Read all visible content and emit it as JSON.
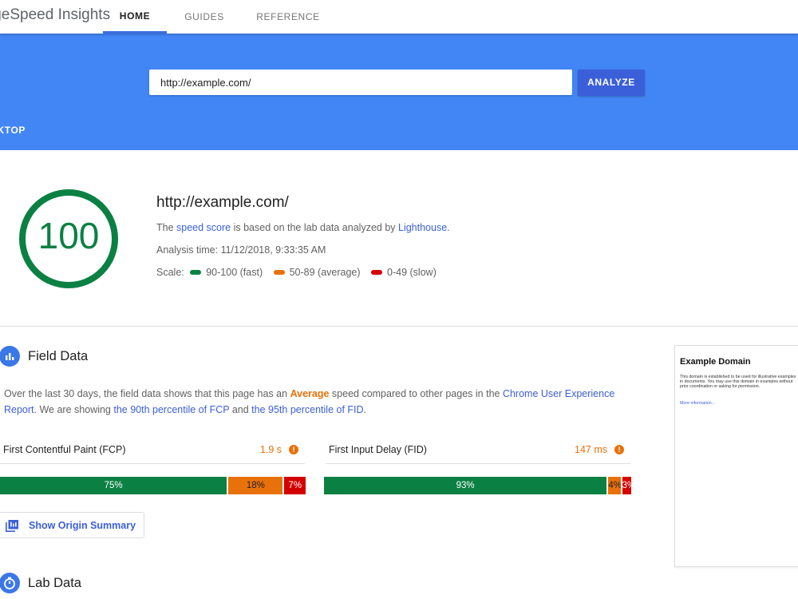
{
  "app": {
    "title": "PageSpeed Insights"
  },
  "nav": {
    "tabs": [
      {
        "label": "HOME"
      },
      {
        "label": "GUIDES"
      },
      {
        "label": "REFERENCE"
      }
    ]
  },
  "search": {
    "value": "http://example.com/",
    "analyze_label": "ANALYZE",
    "device_tab": "DESKTOP"
  },
  "summary": {
    "score": "100",
    "url": "http://example.com/",
    "line1_pre": "The ",
    "line1_link1": "speed score",
    "line1_mid": " is based on the lab data analyzed by ",
    "line1_link2": "Lighthouse",
    "line1_post": ".",
    "analysis_time": "Analysis time: 11/12/2018, 9:33:35 AM",
    "scale_label": "Scale:",
    "scale": [
      {
        "label": "90-100 (fast)",
        "color": "#0b8043"
      },
      {
        "label": "50-89 (average)",
        "color": "#e8710a"
      },
      {
        "label": "0-49 (slow)",
        "color": "#d50000"
      }
    ]
  },
  "field_data": {
    "title": "Field Data",
    "desc_1": "Over the last 30 days, the field data shows that this page has an ",
    "desc_rating": "Average",
    "desc_2": " speed compared to other pages in the ",
    "desc_link1": "Chrome User Experience Report",
    "desc_3": ". We are showing ",
    "desc_link2": "the 90th percentile of FCP",
    "desc_4": " and ",
    "desc_link3": "the 95th percentile of FID",
    "desc_5": ".",
    "metrics": [
      {
        "name": "First Contentful Paint (FCP)",
        "value": "1.9 s",
        "info": "!",
        "dist": [
          {
            "label": "75%",
            "pct": 75
          },
          {
            "label": "18%",
            "pct": 18
          },
          {
            "label": "7%",
            "pct": 7
          }
        ]
      },
      {
        "name": "First Input Delay (FID)",
        "value": "147 ms",
        "info": "!",
        "dist": [
          {
            "label": "93%",
            "pct": 93
          },
          {
            "label": "4%",
            "pct": 4
          },
          {
            "label": "3%",
            "pct": 3
          }
        ]
      }
    ],
    "origin_button": "Show Origin Summary"
  },
  "lab_data": {
    "title": "Lab Data"
  },
  "screenshot": {
    "title": "Example Domain",
    "body": "This domain is established to be used for illustrative examples in documents. You may use this domain in examples without prior coordination or asking for permission.",
    "link": "More information..."
  },
  "colors": {
    "brand_blue": "#4285f4",
    "button_blue": "#3b5fd8",
    "fast": "#0b8043",
    "average": "#e8710a",
    "slow": "#d50000"
  }
}
